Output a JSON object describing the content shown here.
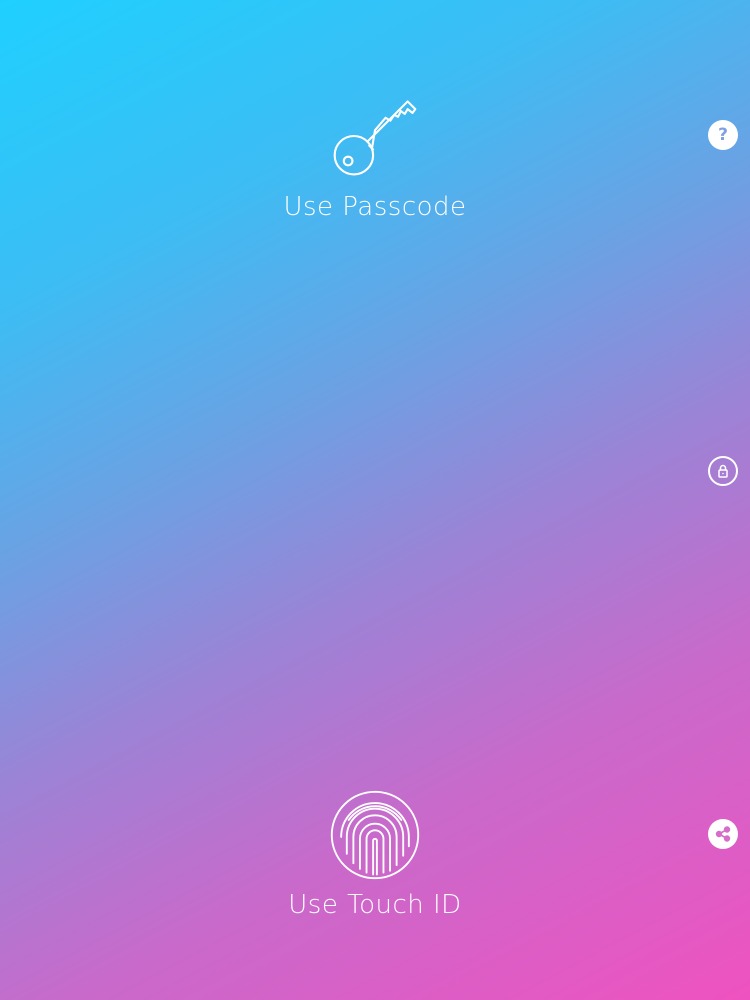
{
  "passcode_option": {
    "label": "Use Passcode",
    "icon": "key-icon"
  },
  "touchid_option": {
    "label": "Use Touch ID",
    "icon": "fingerprint-icon"
  },
  "side_controls": {
    "help_glyph": "?",
    "help_icon": "help-icon",
    "lock_icon": "lock-rotate-icon",
    "share_icon": "share-icon"
  },
  "colors": {
    "gradient_top_left": "#1fd0ff",
    "gradient_bottom_right": "#ef52c0",
    "foreground": "#ffffff"
  }
}
